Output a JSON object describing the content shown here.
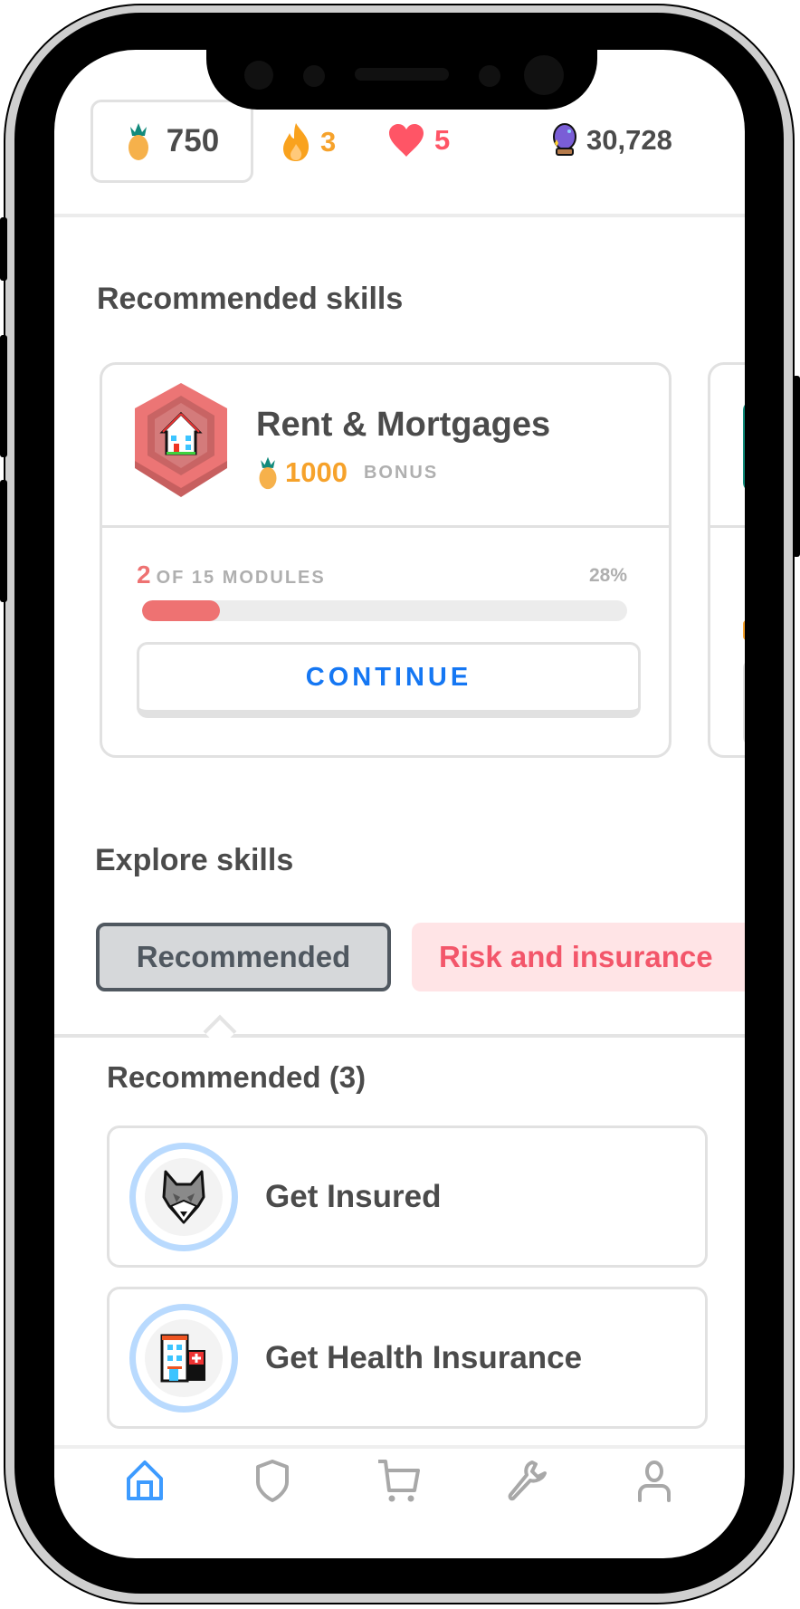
{
  "status_bar": {
    "pineapples": "750",
    "streak": "3",
    "hearts": "5",
    "gems": "30,728",
    "colors": {
      "streak": "#f6a22b",
      "hearts": "#ff5566",
      "text": "#4b4b4b"
    }
  },
  "recommended_skills": {
    "title": "Recommended skills",
    "cards": [
      {
        "title": "Rent & Mortgages",
        "icon": "house-badge-icon",
        "bonus_value": "1000",
        "bonus_label": "BONUS",
        "modules_done": "2",
        "modules_text": "OF 15 MODULES",
        "percent_label": "28%",
        "progress_fraction": 0.16,
        "button_label": "CONTINUE"
      }
    ]
  },
  "explore_skills": {
    "title": "Explore skills",
    "chips": [
      {
        "label": "Recommended",
        "active": true
      },
      {
        "label": "Risk and insurance",
        "active": false
      }
    ],
    "list_title": "Recommended (3)",
    "items": [
      {
        "label": "Get Insured",
        "icon": "wolf-icon"
      },
      {
        "label": "Get Health Insurance",
        "icon": "hospital-icon"
      }
    ]
  },
  "bottom_nav": {
    "items": [
      {
        "name": "home",
        "active": true
      },
      {
        "name": "shield",
        "active": false
      },
      {
        "name": "cart",
        "active": false
      },
      {
        "name": "wrench",
        "active": false
      },
      {
        "name": "profile",
        "active": false
      }
    ],
    "active_color": "#3d9bff",
    "inactive_color": "#a8a8a8"
  }
}
